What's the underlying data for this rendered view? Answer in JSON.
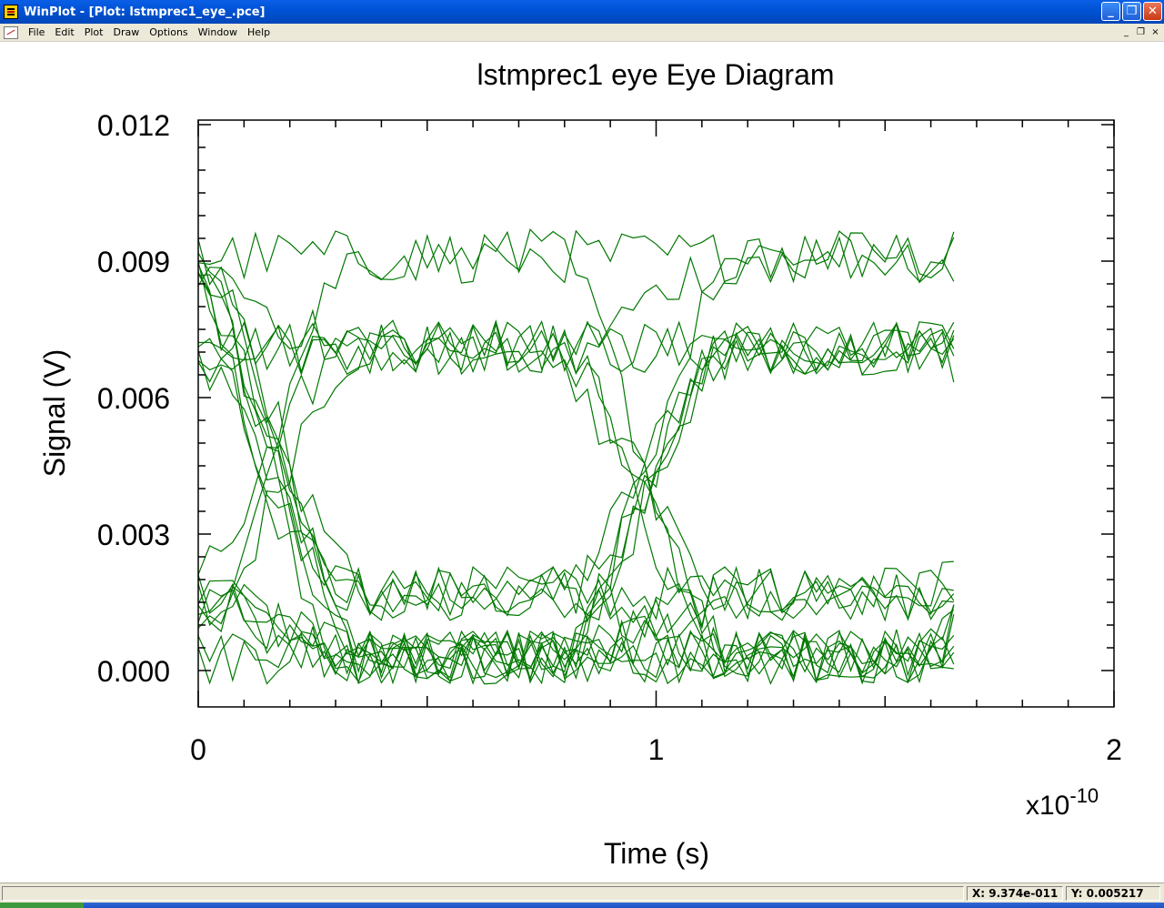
{
  "window": {
    "title": "WinPlot - [Plot: lstmprec1_eye_.pce]",
    "controls": {
      "minimize": "_",
      "maximize": "❐",
      "close": "✕"
    },
    "mdi_controls": {
      "minimize": "_",
      "restore": "❐",
      "close": "×"
    }
  },
  "menu": {
    "items": [
      "File",
      "Edit",
      "Plot",
      "Draw",
      "Options",
      "Window",
      "Help"
    ]
  },
  "status": {
    "x": "X: 9.374e-011",
    "y": "Y: 0.005217"
  },
  "colors": {
    "trace": "#007800",
    "titlebar": "#0053d6"
  },
  "chart_data": {
    "type": "line",
    "title": "lstmprec1 eye  Eye Diagram",
    "xlabel": "Time (s)",
    "ylabel": "Signal (V)",
    "x_multiplier_base": "x10",
    "x_multiplier_exp": "-10",
    "x_ticks": [
      "0",
      "1",
      "2"
    ],
    "y_ticks": [
      "0.000",
      "0.003",
      "0.006",
      "0.009",
      "0.012"
    ],
    "xlim": [
      0,
      2
    ],
    "ylim": [
      -0.0008,
      0.0121
    ],
    "x_data_range_max": 1.65,
    "unit_interval": 0.82,
    "first_crossing": 0.16,
    "levels": [
      0.0003,
      0.0017,
      0.0071,
      0.0091
    ],
    "crossing_levels": [
      0.0007,
      0.003,
      0.0067
    ],
    "noise_amplitude": 0.0012,
    "sample_step": 0.025,
    "traces_per_pattern": 6,
    "grid": false,
    "legend": "none"
  }
}
